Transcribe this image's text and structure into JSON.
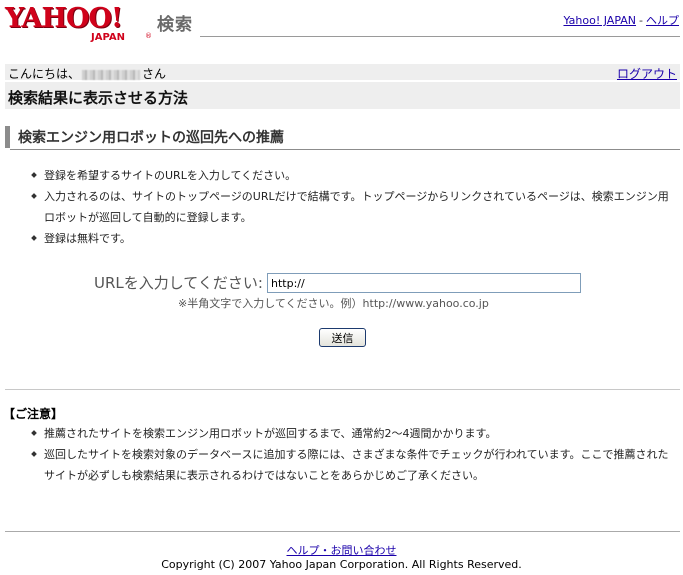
{
  "header": {
    "logo_main": "YAHOO!",
    "logo_sub": "JAPAN",
    "logo_reg": "®",
    "service_name": "検索",
    "links": [
      {
        "label": "Yahoo! JAPAN"
      },
      {
        "label": "ヘルプ"
      }
    ],
    "link_separator": "-"
  },
  "greeting": {
    "prefix": "こんにちは、",
    "suffix": "さん",
    "logout_label": "ログアウト"
  },
  "page_title": "検索結果に表示させる方法",
  "section": {
    "title": "検索エンジン用ロボットの巡回先への推薦"
  },
  "instructions": [
    "登録を希望するサイトのURLを入力してください。",
    "入力されるのは、サイトのトップページのURLだけで結構です。トップページからリンクされているページは、検索エンジン用ロボットが巡回して自動的に登録します。",
    "登録は無料です。"
  ],
  "form": {
    "url_label": "URLを入力してください:",
    "url_value": "http://",
    "note": "※半角文字で入力してください。例）http://www.yahoo.co.jp",
    "submit_label": "送信"
  },
  "notice": {
    "title": "【ご注意】",
    "items": [
      "推薦されたサイトを検索エンジン用ロボットが巡回するまで、通常約2〜4週間かかります。",
      "巡回したサイトを検索対象のデータベースに追加する際には、さまざまな条件でチェックが行われています。ここで推薦されたサイトが必ずしも検索結果に表示されるわけではないことをあらかじめご了承ください。"
    ]
  },
  "footer": {
    "help_link": "ヘルプ・お問い合わせ",
    "copyright": "Copyright (C) 2007 Yahoo Japan Corporation. All Rights Reserved."
  },
  "colors": {
    "brand_red": "#d0021b",
    "link": "#1a00aa",
    "bar_gray": "#eeeeee"
  }
}
